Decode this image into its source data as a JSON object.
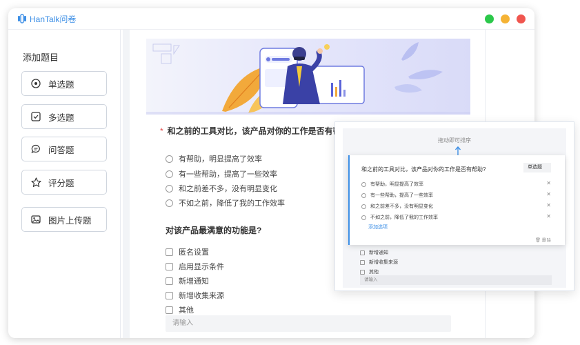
{
  "app": {
    "name": "HanTalk问卷"
  },
  "window_controls": {
    "colors": [
      "#2bc84a",
      "#f5b335",
      "#f0564f"
    ]
  },
  "sidebar": {
    "title": "添加题目",
    "items": [
      {
        "label": "单选题",
        "icon": "radio-circle-icon"
      },
      {
        "label": "多选题",
        "icon": "checkbox-icon"
      },
      {
        "label": "问答题",
        "icon": "chat-bubble-icon"
      },
      {
        "label": "评分题",
        "icon": "star-icon"
      },
      {
        "label": "图片上传题",
        "icon": "image-icon"
      }
    ]
  },
  "survey": {
    "q1": {
      "required_mark": "*",
      "title": "和之前的工具对比，该产品对你的工作是否有帮助?",
      "options": [
        "有帮助，明显提高了效率",
        "有一些帮助，提高了一些效率",
        "和之前差不多，没有明显变化",
        "不如之前，降低了我的工作效率"
      ]
    },
    "q2": {
      "title": "对该产品最满意的功能是?",
      "options": [
        "匿名设置",
        "启用显示条件",
        "新增通知",
        "新增收集来源",
        "其他"
      ],
      "input_placeholder": "请输入"
    }
  },
  "preview": {
    "drag_tip": "拖动即可排序",
    "question": "和之前的工具对比，该产品对你的工作是否有帮助?",
    "type_label": "单选题",
    "options": [
      "有帮助，明显提高了效率",
      "有一些帮助，提高了一些效率",
      "和之前差不多，没有明显变化",
      "不如之前，降低了我的工作效率"
    ],
    "add_option": "添加选项",
    "delete_label": "删除",
    "checkbox_options": [
      "新增通知",
      "新增收集来源",
      "其他"
    ],
    "input_placeholder": "请输入"
  },
  "colors": {
    "accent": "#3d8fe6",
    "required": "#e34d4d"
  }
}
